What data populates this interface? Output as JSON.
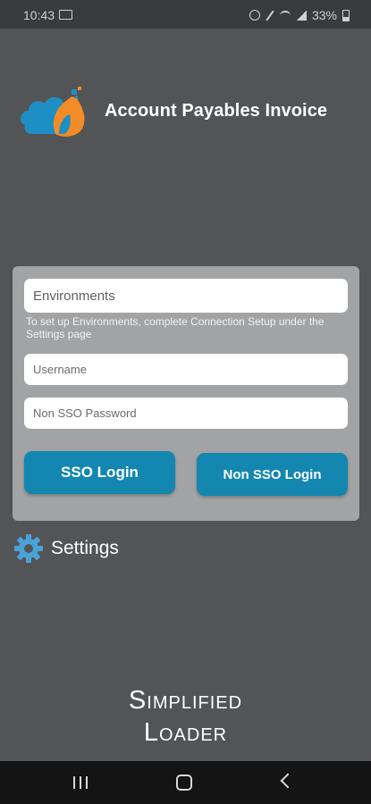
{
  "status_bar": {
    "time": "10:43",
    "battery": "33%"
  },
  "app": {
    "title": "Account Payables Invoice"
  },
  "login": {
    "environment_label": "Environments",
    "environment_hint": "To set up Environments, complete Connection Setup under the Settings page",
    "username_placeholder": "Username",
    "password_placeholder": "Non SSO Password",
    "sso_button": "SSO Login",
    "non_sso_button": "Non SSO Login"
  },
  "settings": {
    "label": "Settings"
  },
  "brand": {
    "line1": "Simplified",
    "line2": "Loader"
  },
  "colors": {
    "background": "#535456",
    "card": "#a2a3a5",
    "button": "#1387b0",
    "logo_blue": "#1e8fc4",
    "logo_orange": "#f28c28"
  },
  "icons": [
    "screen-icon",
    "alarm-icon",
    "mute-icon",
    "wifi-icon",
    "signal-icon",
    "battery-icon",
    "gear-icon",
    "recents-icon",
    "home-icon",
    "back-icon"
  ]
}
